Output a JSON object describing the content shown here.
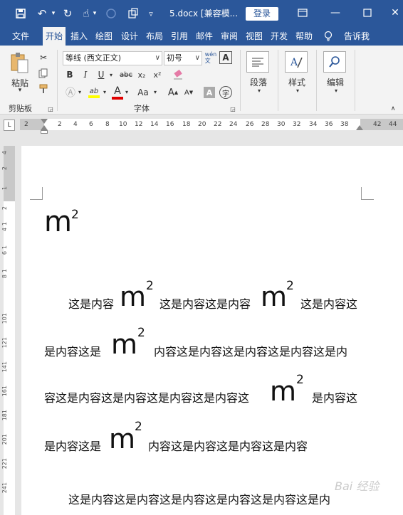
{
  "title_bar": {
    "document_title": "5.docx [兼容模...",
    "login_label": "登录",
    "quick_access": [
      "save-icon",
      "undo-icon",
      "redo-icon",
      "touch-mode-icon",
      "autosave-icon",
      "format-painter-icon",
      "customize-icon"
    ],
    "window_controls": [
      "ribbon-display-icon",
      "minimize-icon",
      "maximize-icon",
      "close-icon"
    ]
  },
  "tabs": [
    {
      "label": "文件"
    },
    {
      "label": "开始",
      "active": true
    },
    {
      "label": "插入"
    },
    {
      "label": "绘图"
    },
    {
      "label": "设计"
    },
    {
      "label": "布局"
    },
    {
      "label": "引用"
    },
    {
      "label": "邮件"
    },
    {
      "label": "审阅"
    },
    {
      "label": "视图"
    },
    {
      "label": "开发"
    },
    {
      "label": "帮助"
    },
    {
      "label": "告诉我"
    }
  ],
  "ribbon": {
    "clipboard": {
      "paste_label": "粘贴",
      "group_label": "剪贴板"
    },
    "font": {
      "font_name": "等线 (西文正文)",
      "font_size": "初号",
      "phonetic_label": "wén\n文",
      "group_label": "字体",
      "buttons": {
        "bold": "B",
        "italic": "I",
        "underline": "U",
        "strike": "abc",
        "subscript": "x₂",
        "superscript": "x²",
        "font_color": "A",
        "change_case": "Aa",
        "grow": "A",
        "shrink": "A",
        "char_shading": "A",
        "enclose": "字"
      }
    },
    "paragraph": {
      "label": "段落"
    },
    "styles": {
      "label": "样式"
    },
    "editing": {
      "label": "编辑"
    }
  },
  "ruler": {
    "tick_labels": [
      "2",
      "2",
      "4",
      "6",
      "8",
      "10",
      "12",
      "14",
      "16",
      "18",
      "20",
      "22",
      "24",
      "26",
      "28",
      "30",
      "32",
      "34",
      "36",
      "38",
      "42",
      "44"
    ],
    "corner_label": "L"
  },
  "vertical_ruler": {
    "tick_labels": [
      "4",
      "2",
      "1",
      "2",
      "1",
      "4",
      "1",
      "6",
      "1",
      "8",
      "101",
      "121",
      "141",
      "161",
      "181",
      "201",
      "221",
      "241"
    ]
  },
  "document": {
    "base": "m",
    "exponent": "2",
    "paragraph1": [
      "这是内容",
      "这是内容这是内容",
      "这是内容这",
      "是内容这是",
      "内容这是内容这是内容这是内容这是内",
      "容这是内容这是内容这是内容这是内容这",
      "是内容这",
      "是内容这是",
      "内容这是内容这是内容这是内容"
    ],
    "paragraph2_partial": "这是内容这是内容这是内容这是内容这是内容这是内"
  },
  "watermark": "Bai 经验"
}
